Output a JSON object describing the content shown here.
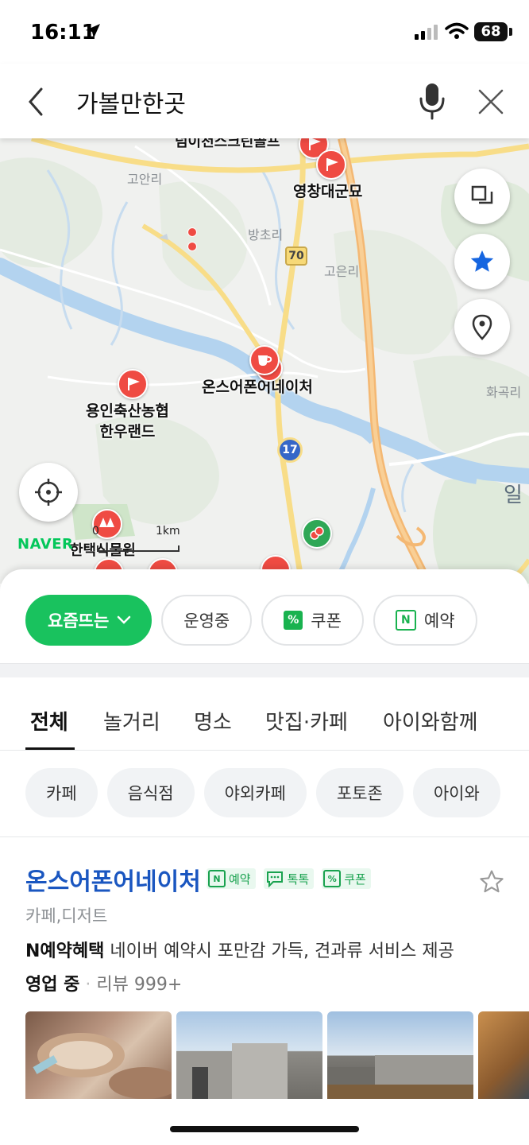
{
  "status_bar": {
    "time": "16:11",
    "battery": "68"
  },
  "search": {
    "query": "가볼만한곳"
  },
  "map": {
    "labels": {
      "top_cut": "덤이천스크린골프",
      "gonanri": "고안리",
      "yeongchang": "영창대군묘",
      "bangchori": "방초리",
      "goeunri": "고은리",
      "route70": "70",
      "onsof": "온스어폰어네이처",
      "hwagokri": "화곡리",
      "yongin_line1": "용인축산농협",
      "yongin_line2": "한우랜드",
      "route17": "17",
      "edge_il": "일",
      "arboretum": "한택식물원"
    },
    "scale": {
      "zero": "0",
      "km": "1km"
    },
    "brand": "NAVER"
  },
  "filters": [
    {
      "label": "요즘뜨는",
      "icon": "chevron-down-icon"
    },
    {
      "label": "운영중"
    },
    {
      "label": "쿠폰",
      "icon": "coupon-icon"
    },
    {
      "label": "예약",
      "icon": "naver-booking-icon"
    }
  ],
  "tabs": [
    "전체",
    "놀거리",
    "명소",
    "맛집·카페",
    "아이와함께"
  ],
  "categories": [
    "카페",
    "음식점",
    "야외카페",
    "포토존",
    "아이와"
  ],
  "place": {
    "name": "온스어폰어네이처",
    "badges": [
      {
        "icon": "N",
        "label": "예약"
      },
      {
        "icon": "talk",
        "label": "톡톡"
      },
      {
        "icon": "%",
        "label": "쿠폰"
      }
    ],
    "category": "카페,디저트",
    "benefit_title": "N예약혜택",
    "benefit_text": "네이버 예약시 포만감 가득, 견과류 서비스 제공",
    "status": "영업 중",
    "dot": "·",
    "review": "리뷰 999+"
  },
  "colors": {
    "accent_green": "#19c25e",
    "place_name_blue": "#1a56c0",
    "pin_red": "#ef4b43",
    "favorite_blue": "#1565e0"
  }
}
